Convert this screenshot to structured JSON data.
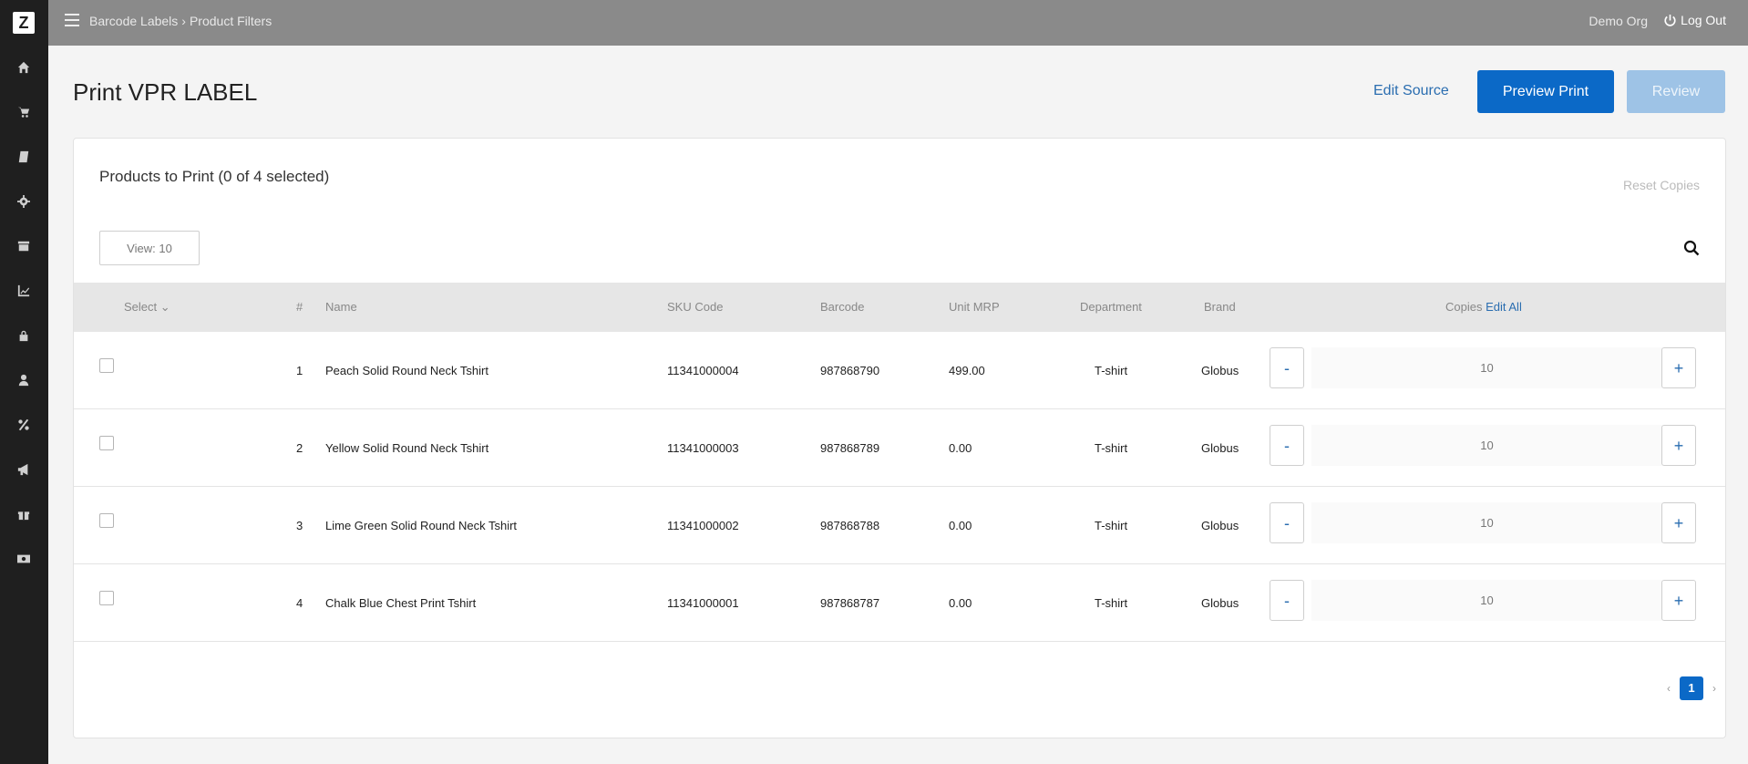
{
  "sidebar": {
    "logo": "Z",
    "items": [
      {
        "icon": "home-icon"
      },
      {
        "icon": "cart-icon"
      },
      {
        "icon": "book-icon"
      },
      {
        "icon": "gear-icon"
      },
      {
        "icon": "inventory-icon"
      },
      {
        "icon": "chart-icon"
      },
      {
        "icon": "lock-icon"
      },
      {
        "icon": "user-icon"
      },
      {
        "icon": "percent-icon"
      },
      {
        "icon": "megaphone-icon"
      },
      {
        "icon": "gift-icon"
      },
      {
        "icon": "cash-icon"
      }
    ]
  },
  "topbar": {
    "breadcrumb_1": "Barcode Labels",
    "breadcrumb_sep": "›",
    "breadcrumb_2": "Product Filters",
    "org": "Demo Org",
    "logout": "Log Out"
  },
  "header": {
    "title": "Print VPR LABEL",
    "edit_source": "Edit Source",
    "preview_print": "Preview Print",
    "review": "Review"
  },
  "card": {
    "title": "Products to Print (0 of 4 selected)",
    "reset_copies": "Reset Copies",
    "view": "View: 10"
  },
  "table": {
    "headers": {
      "select": "Select",
      "num": "#",
      "name": "Name",
      "sku": "SKU Code",
      "barcode": "Barcode",
      "mrp": "Unit MRP",
      "department": "Department",
      "brand": "Brand",
      "copies": "Copies",
      "edit_all": "Edit All"
    },
    "minus": "-",
    "plus": "+",
    "rows": [
      {
        "num": "1",
        "name": "Peach Solid Round Neck Tshirt",
        "sku": "11341000004",
        "barcode": "987868790",
        "mrp": "499.00",
        "department": "T-shirt",
        "brand": "Globus",
        "copies": "10"
      },
      {
        "num": "2",
        "name": "Yellow Solid Round Neck Tshirt",
        "sku": "11341000003",
        "barcode": "987868789",
        "mrp": "0.00",
        "department": "T-shirt",
        "brand": "Globus",
        "copies": "10"
      },
      {
        "num": "3",
        "name": "Lime Green Solid Round Neck Tshirt",
        "sku": "11341000002",
        "barcode": "987868788",
        "mrp": "0.00",
        "department": "T-shirt",
        "brand": "Globus",
        "copies": "10"
      },
      {
        "num": "4",
        "name": "Chalk Blue Chest Print Tshirt",
        "sku": "11341000001",
        "barcode": "987868787",
        "mrp": "0.00",
        "department": "T-shirt",
        "brand": "Globus",
        "copies": "10"
      }
    ]
  },
  "pagination": {
    "prev": "‹",
    "current": "1",
    "next": "›"
  }
}
